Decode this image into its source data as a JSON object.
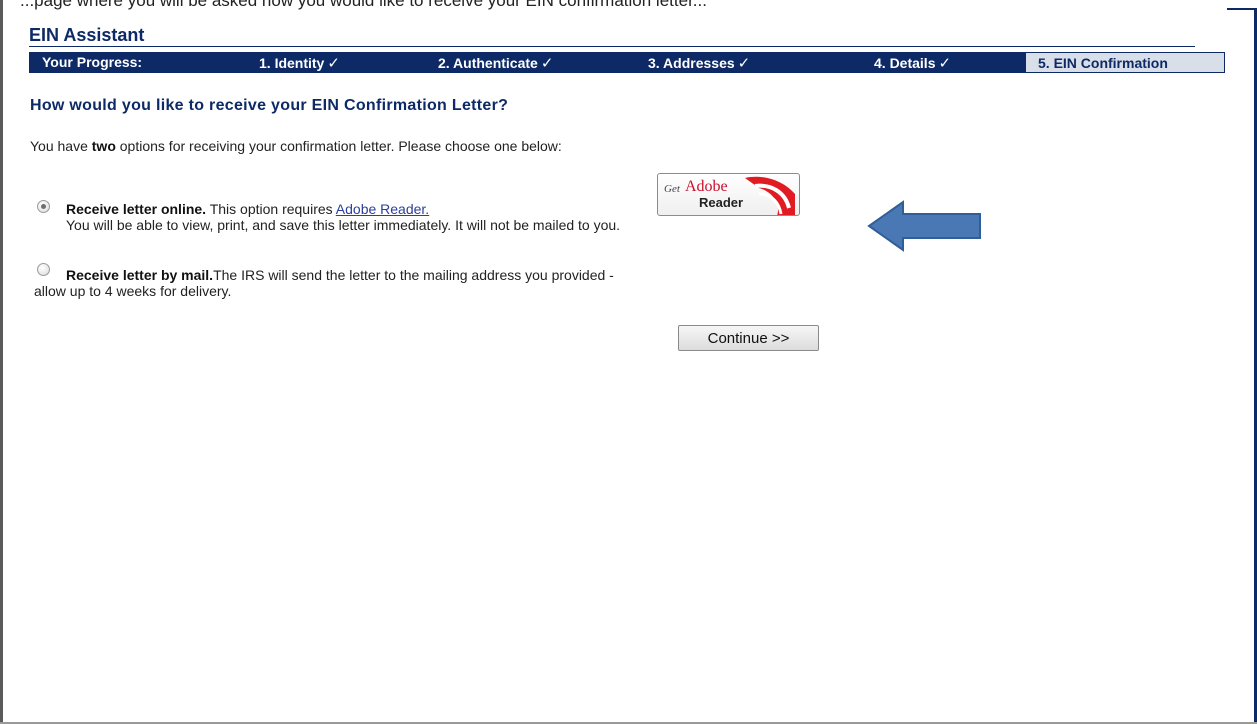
{
  "top_caption": "...page where you will be asked how you would like to receive your EIN confirmation letter...",
  "app": {
    "title": "EIN Assistant"
  },
  "progress": {
    "label": "Your Progress:",
    "check": "✓",
    "steps": [
      {
        "label": "1. Identity",
        "done": true
      },
      {
        "label": "2. Authenticate",
        "done": true
      },
      {
        "label": "3. Addresses",
        "done": true
      },
      {
        "label": "4. Details",
        "done": true
      },
      {
        "label": "5. EIN Confirmation",
        "current": true
      }
    ]
  },
  "main": {
    "question": "How would you like to receive your EIN Confirmation Letter?",
    "intro_prefix": "You have ",
    "intro_bold": "two",
    "intro_suffix": " options for receiving your confirmation letter. Please choose one below:",
    "options": [
      {
        "title": "Receive letter online.",
        "text": " This option requires ",
        "link": "Adobe Reader.",
        "detail": "You will be able to view, print, and save this letter immediately. It will not be mailed to you.",
        "selected": true
      },
      {
        "title": "Receive letter by mail.",
        "text": "The IRS will send the letter to the mailing address you provided -",
        "detail": "allow up to 4 weeks for delivery.",
        "selected": false
      }
    ],
    "adobe_badge": {
      "get": "Get",
      "brand": "Adobe",
      "product": "Reader"
    },
    "continue_label": "Continue >>"
  },
  "colors": {
    "navy": "#0d2a66",
    "current_step_bg": "#d9dfe9",
    "arrow_fill": "#4a78b4",
    "link": "#2a3f9a",
    "adobe_red": "#c8102e"
  },
  "icons": {
    "arrow": "left-arrow-icon",
    "adobe": "adobe-reader-icon"
  }
}
